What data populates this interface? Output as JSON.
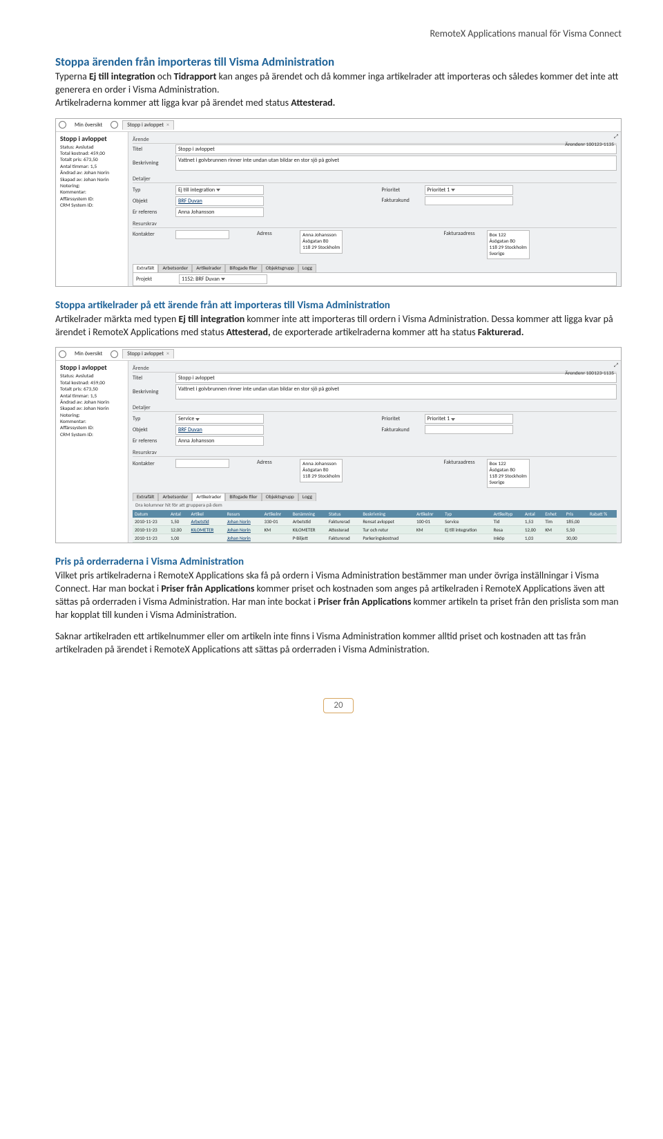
{
  "header": {
    "title": "RemoteX Applications manual för Visma Connect"
  },
  "sec1": {
    "title": "Stoppa ärenden från importeras till Visma Administration",
    "p1a": "Typerna ",
    "p1b": "Ej till integration",
    "p1c": " och ",
    "p1d": "Tidrapport",
    "p1e": " kan anges på ärendet och då kommer inga artikelrader att importeras och således kommer det inte att generera en order i Visma Administration.",
    "p1f": "Artikelraderna kommer att ligga kvar på ärendet med status ",
    "p1g": "Attesterad."
  },
  "sec2": {
    "title": "Stoppa artikelrader på ett ärende från att importeras till Visma Administration",
    "p1a": "Artikelrader märkta med typen ",
    "p1b": "Ej till integration",
    "p1c": " kommer inte att importeras till ordern i Visma Administration. Dessa kommer att ligga kvar på ärendet i RemoteX Applications med status ",
    "p1d": "Attesterad,",
    "p1e": " de exporterade artikelraderna kommer att ha status ",
    "p1f": "Fakturerad."
  },
  "sec3": {
    "title": "Pris på orderraderna i Visma Administration",
    "p1a": "Vilket pris artikelraderna i RemoteX Applications ska få på ordern i Visma Administration bestämmer man under övriga inställningar i Visma Connect. Har man bockat i ",
    "p1b": "Priser från Applications",
    "p1c": " kommer priset och kostnaden som anges på artikelraden i RemoteX Applications även att sättas på orderraden i Visma Administration. Har man inte bockat i ",
    "p1d": " kommer artikeln ta priset från den prislista som man har kopplat till kunden i Visma Administration.",
    "p2": "Saknar artikelraden ett artikelnummer eller om artikeln inte finns i Visma Administration kommer alltid priset och kostnaden att tas från artikelraden på ärendet i RemoteX Applications att sättas på orderraden i Visma Administration."
  },
  "shot_common": {
    "tab_overview": "Min översikt",
    "tab_case": "Stopp i avloppet",
    "side_title": "Stopp i avloppet",
    "status_lbl": "Status:",
    "status_val": "Avslutad",
    "tot_kost_lbl": "Total kostnad:",
    "tot_kost_val": "459,00",
    "tot_pris_lbl": "Totalt pris:",
    "tot_pris_val": "673,50",
    "tot_tim_lbl": "Antal timmar:",
    "tot_tim_val": "1,5",
    "andrad_lbl": "Ändrad av:",
    "andrad_val": "Johan Norin",
    "skapad_lbl": "Skapad av:",
    "skapad_val": "Johan Norin",
    "notering_lbl": "Notering:",
    "kommentar_lbl": "Kommentar:",
    "aff_lbl": "Affärssystem ID:",
    "crm_lbl": "CRM System ID:",
    "sect_arende": "Ärende",
    "lbl_titel": "Titel",
    "val_titel": "Stopp i avloppet",
    "arendenr": "Ärendenr 100123-1135",
    "lbl_besk": "Beskrivning",
    "val_besk": "Vattnet i golvbrunnen rinner inte undan utan bildar en stor sjö på golvet",
    "sect_detaljer": "Detaljer",
    "lbl_typ": "Typ",
    "lbl_prio": "Prioritet",
    "val_prio": "Prioritet 1",
    "lbl_objekt": "Objekt",
    "val_objekt": "BRF Duvan",
    "lbl_fakt": "Fakturakund",
    "lbl_ref": "Er referens",
    "val_ref": "Anna Johansson",
    "sect_resurs": "Resurskrav",
    "lbl_kontakter": "Kontakter",
    "lbl_adress": "Adress",
    "adr1": "Anna Johansson",
    "adr2": "Åsögatan 80",
    "adr3": "118 29 Stockholm",
    "lbl_faktadr": "Fakturaadress",
    "faktadr1": "Box 122",
    "faktadr2": "Åsögatan 80",
    "faktadr3": "118 29 Stockholm",
    "faktadr4": "Sverige",
    "sverige": "Sverige",
    "subtabs": [
      "Extrafält",
      "Arbetsorder",
      "Artikelrader",
      "Bifogade filer",
      "Objektsgrupp",
      "Logg"
    ],
    "projekt_lbl": "Projekt",
    "projekt_val": "1152: BRF Duvan"
  },
  "shot1": {
    "typ_val": "Ej till integration",
    "active_subtab": 0
  },
  "shot2": {
    "typ_val": "Service",
    "active_subtab": 2,
    "drag_note": "Dra kolumner hit för att gruppera på dem",
    "art_headers": [
      "Datum",
      "Antal",
      "Artikel",
      "Resurs",
      "Artikelnr",
      "Benämning",
      "Status",
      "Beskrivning",
      "Artikelnr",
      "Typ",
      "Artikeltyp",
      "Antal",
      "Enhet",
      "Pris",
      "Rabatt %"
    ],
    "art_rows": [
      [
        "2010-11-23",
        "1,50",
        "Arbetstid",
        "Johan Norin",
        "330-01",
        "Arbetstid",
        "Fakturerad",
        "Rensat avloppet",
        "100-01",
        "Service",
        "Tid",
        "1,53",
        "Tim",
        "185,00",
        ""
      ],
      [
        "2010-11-23",
        "12,00",
        "KILOMETER",
        "Johan Norin",
        "KM",
        "KILOMETER",
        "Attesterad",
        "Tur och retur",
        "KM",
        "Ej till integration",
        "Resa",
        "12,00",
        "KM",
        "5,50",
        ""
      ],
      [
        "2010-11-23",
        "1,00",
        "",
        "Johan Norin",
        "",
        "P-Biljett",
        "Fakturerad",
        "Parkeringskostnad",
        "",
        "",
        "Inköp",
        "1,03",
        "",
        "30,00",
        ""
      ]
    ]
  },
  "page_number": "20"
}
